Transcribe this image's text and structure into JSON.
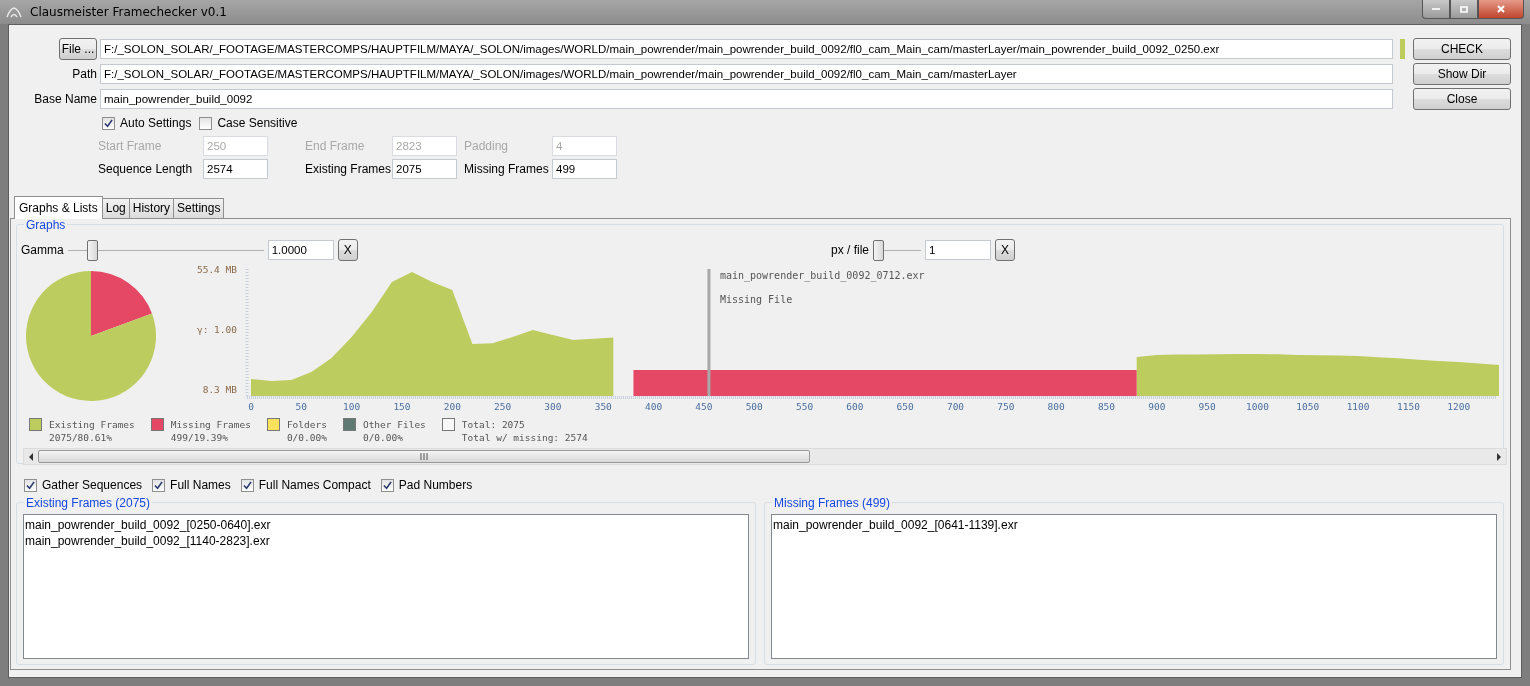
{
  "window": {
    "title": "Clausmeister Framechecker v0.1"
  },
  "path_rows": [
    {
      "kind": "button",
      "label": "File ...",
      "value": "F:/_SOLON_SOLAR/_FOOTAGE/MASTERCOMPS/HAUPTFILM/MAYA/_SOLON/images/WORLD/main_powrender/main_powrender_build_0092/fl0_cam_Main_cam/masterLayer/main_powrender_build_0092_0250.exr"
    },
    {
      "kind": "label",
      "label": "Path",
      "value": "F:/_SOLON_SOLAR/_FOOTAGE/MASTERCOMPS/HAUPTFILM/MAYA/_SOLON/images/WORLD/main_powrender/main_powrender_build_0092/fl0_cam_Main_cam/masterLayer"
    },
    {
      "kind": "label",
      "label": "Base Name",
      "value": "main_powrender_build_0092"
    }
  ],
  "side_buttons": [
    "CHECK",
    "Show Dir",
    "Close"
  ],
  "options": [
    {
      "label": "Auto Settings",
      "checked": true
    },
    {
      "label": "Case Sensitive",
      "checked": false
    }
  ],
  "frame_fields": [
    {
      "label": "Start Frame",
      "value": "250",
      "disabled": true
    },
    {
      "label": "End Frame",
      "value": "2823",
      "disabled": true
    },
    {
      "label": "Padding",
      "value": "4",
      "disabled": true
    },
    {
      "label": "Sequence Length",
      "value": "2574",
      "disabled": false
    },
    {
      "label": "Existing Frames",
      "value": "2075",
      "disabled": false
    },
    {
      "label": "Missing Frames",
      "value": "499",
      "disabled": false
    }
  ],
  "tabs": [
    {
      "label": "Graphs & Lists",
      "selected": true
    },
    {
      "label": "Log",
      "selected": false
    },
    {
      "label": "History",
      "selected": false
    },
    {
      "label": "Settings",
      "selected": false
    }
  ],
  "graphs": {
    "title": "Graphs",
    "sliders": [
      {
        "label": "Gamma",
        "level": 0.1,
        "value": "1.0000",
        "reset": "X"
      },
      {
        "label": "px / file",
        "level": 0,
        "value": "1",
        "reset": "X"
      }
    ],
    "pie": {
      "chart_data": {
        "type": "pie",
        "categories": [
          "Existing Frames",
          "Missing Frames",
          "Folders",
          "Other Files"
        ],
        "values": [
          80.61,
          19.39,
          0,
          0
        ],
        "colors": [
          "#bdcc5e",
          "#e54864",
          "#fce25c",
          "#5f7a72"
        ],
        "value_labels": [
          "2075/80.61%",
          "499/19.39%",
          "0/0.00%",
          "0/0.00%"
        ]
      }
    },
    "totals": {
      "color": "#f8f8f8",
      "lines": [
        "Total: 2075",
        "Total w/ missing: 2574"
      ]
    },
    "timeline": {
      "gamma_label": "γ: 1.00",
      "hover_info": [
        "main_powrender_build_0092_0712.exr",
        "Missing File"
      ],
      "chart_data": {
        "type": "area",
        "xlim": [
          0,
          1240
        ],
        "ylim": [
          8.3,
          55.4
        ],
        "yticks": [
          {
            "value": 55.4,
            "label": "55.4 MB"
          },
          {
            "value": 8.3,
            "label": "8.3 MB"
          }
        ],
        "xticks": [
          0,
          50,
          100,
          150,
          200,
          250,
          300,
          350,
          400,
          450,
          500,
          550,
          600,
          650,
          700,
          750,
          800,
          850,
          900,
          950,
          1000,
          1050,
          1100,
          1150,
          1200
        ],
        "ref_lines": [
          {
            "axis": "x",
            "value": 455,
            "color": "#a8a8a8"
          }
        ],
        "x": [
          0,
          20,
          40,
          60,
          80,
          100,
          120,
          140,
          160,
          180,
          200,
          220,
          240,
          260,
          280,
          300,
          320,
          340,
          360,
          380,
          400,
          420,
          440,
          460,
          480,
          500,
          520,
          540,
          560,
          580,
          600,
          620,
          640,
          660,
          680,
          700,
          720,
          740,
          760,
          780,
          800,
          820,
          840,
          860,
          880,
          900,
          920,
          940,
          960,
          980,
          1000,
          1020,
          1040,
          1060,
          1080,
          1100,
          1120,
          1140,
          1160,
          1180,
          1200,
          1220,
          1240
        ],
        "series": [
          {
            "color": "#bdcc5e",
            "values": [
              12.2,
              11.4,
              11.8,
              15.0,
              20.5,
              28.7,
              38.5,
              50.3,
              54.2,
              50.3,
              47.2,
              26.0,
              26.3,
              28.7,
              31.5,
              29.5,
              27.5,
              28.0,
              28.5,
              null,
              null,
              null,
              null,
              null,
              null,
              null,
              null,
              null,
              null,
              null,
              null,
              null,
              null,
              null,
              null,
              null,
              null,
              null,
              null,
              null,
              null,
              null,
              null,
              null,
              20.9,
              21.6,
              21.8,
              21.8,
              21.9,
              22.0,
              22.0,
              21.9,
              21.6,
              21.5,
              21.4,
              21.3,
              20.8,
              20.4,
              19.8,
              19.3,
              18.9,
              18.3,
              17.7
            ]
          },
          {
            "color": "#e54864",
            "values": [
              null,
              null,
              null,
              null,
              null,
              null,
              null,
              null,
              null,
              null,
              null,
              null,
              null,
              null,
              null,
              null,
              null,
              null,
              null,
              15.8,
              15.8,
              15.8,
              15.8,
              15.8,
              15.8,
              15.8,
              15.8,
              15.8,
              15.8,
              15.8,
              15.8,
              15.8,
              15.8,
              15.8,
              15.8,
              15.8,
              15.8,
              15.8,
              15.8,
              15.8,
              15.8,
              15.8,
              15.8,
              15.8,
              15.8,
              null,
              null,
              null,
              null,
              null,
              null,
              null,
              null,
              null,
              null,
              null,
              null,
              null,
              null,
              null,
              null,
              null,
              null
            ]
          }
        ]
      }
    }
  },
  "list_options": [
    {
      "label": "Gather Sequences",
      "checked": true
    },
    {
      "label": "Full Names",
      "checked": true
    },
    {
      "label": "Full Names Compact",
      "checked": true
    },
    {
      "label": "Pad Numbers",
      "checked": true
    }
  ],
  "lists": [
    {
      "title": "Existing Frames (2075)",
      "items": [
        "main_powrender_build_0092_[0250-0640].exr",
        "main_powrender_build_0092_[1140-2823].exr"
      ]
    },
    {
      "title": "Missing Frames (499)",
      "items": [
        "main_powrender_build_0092_[0641-1139].exr"
      ]
    }
  ]
}
